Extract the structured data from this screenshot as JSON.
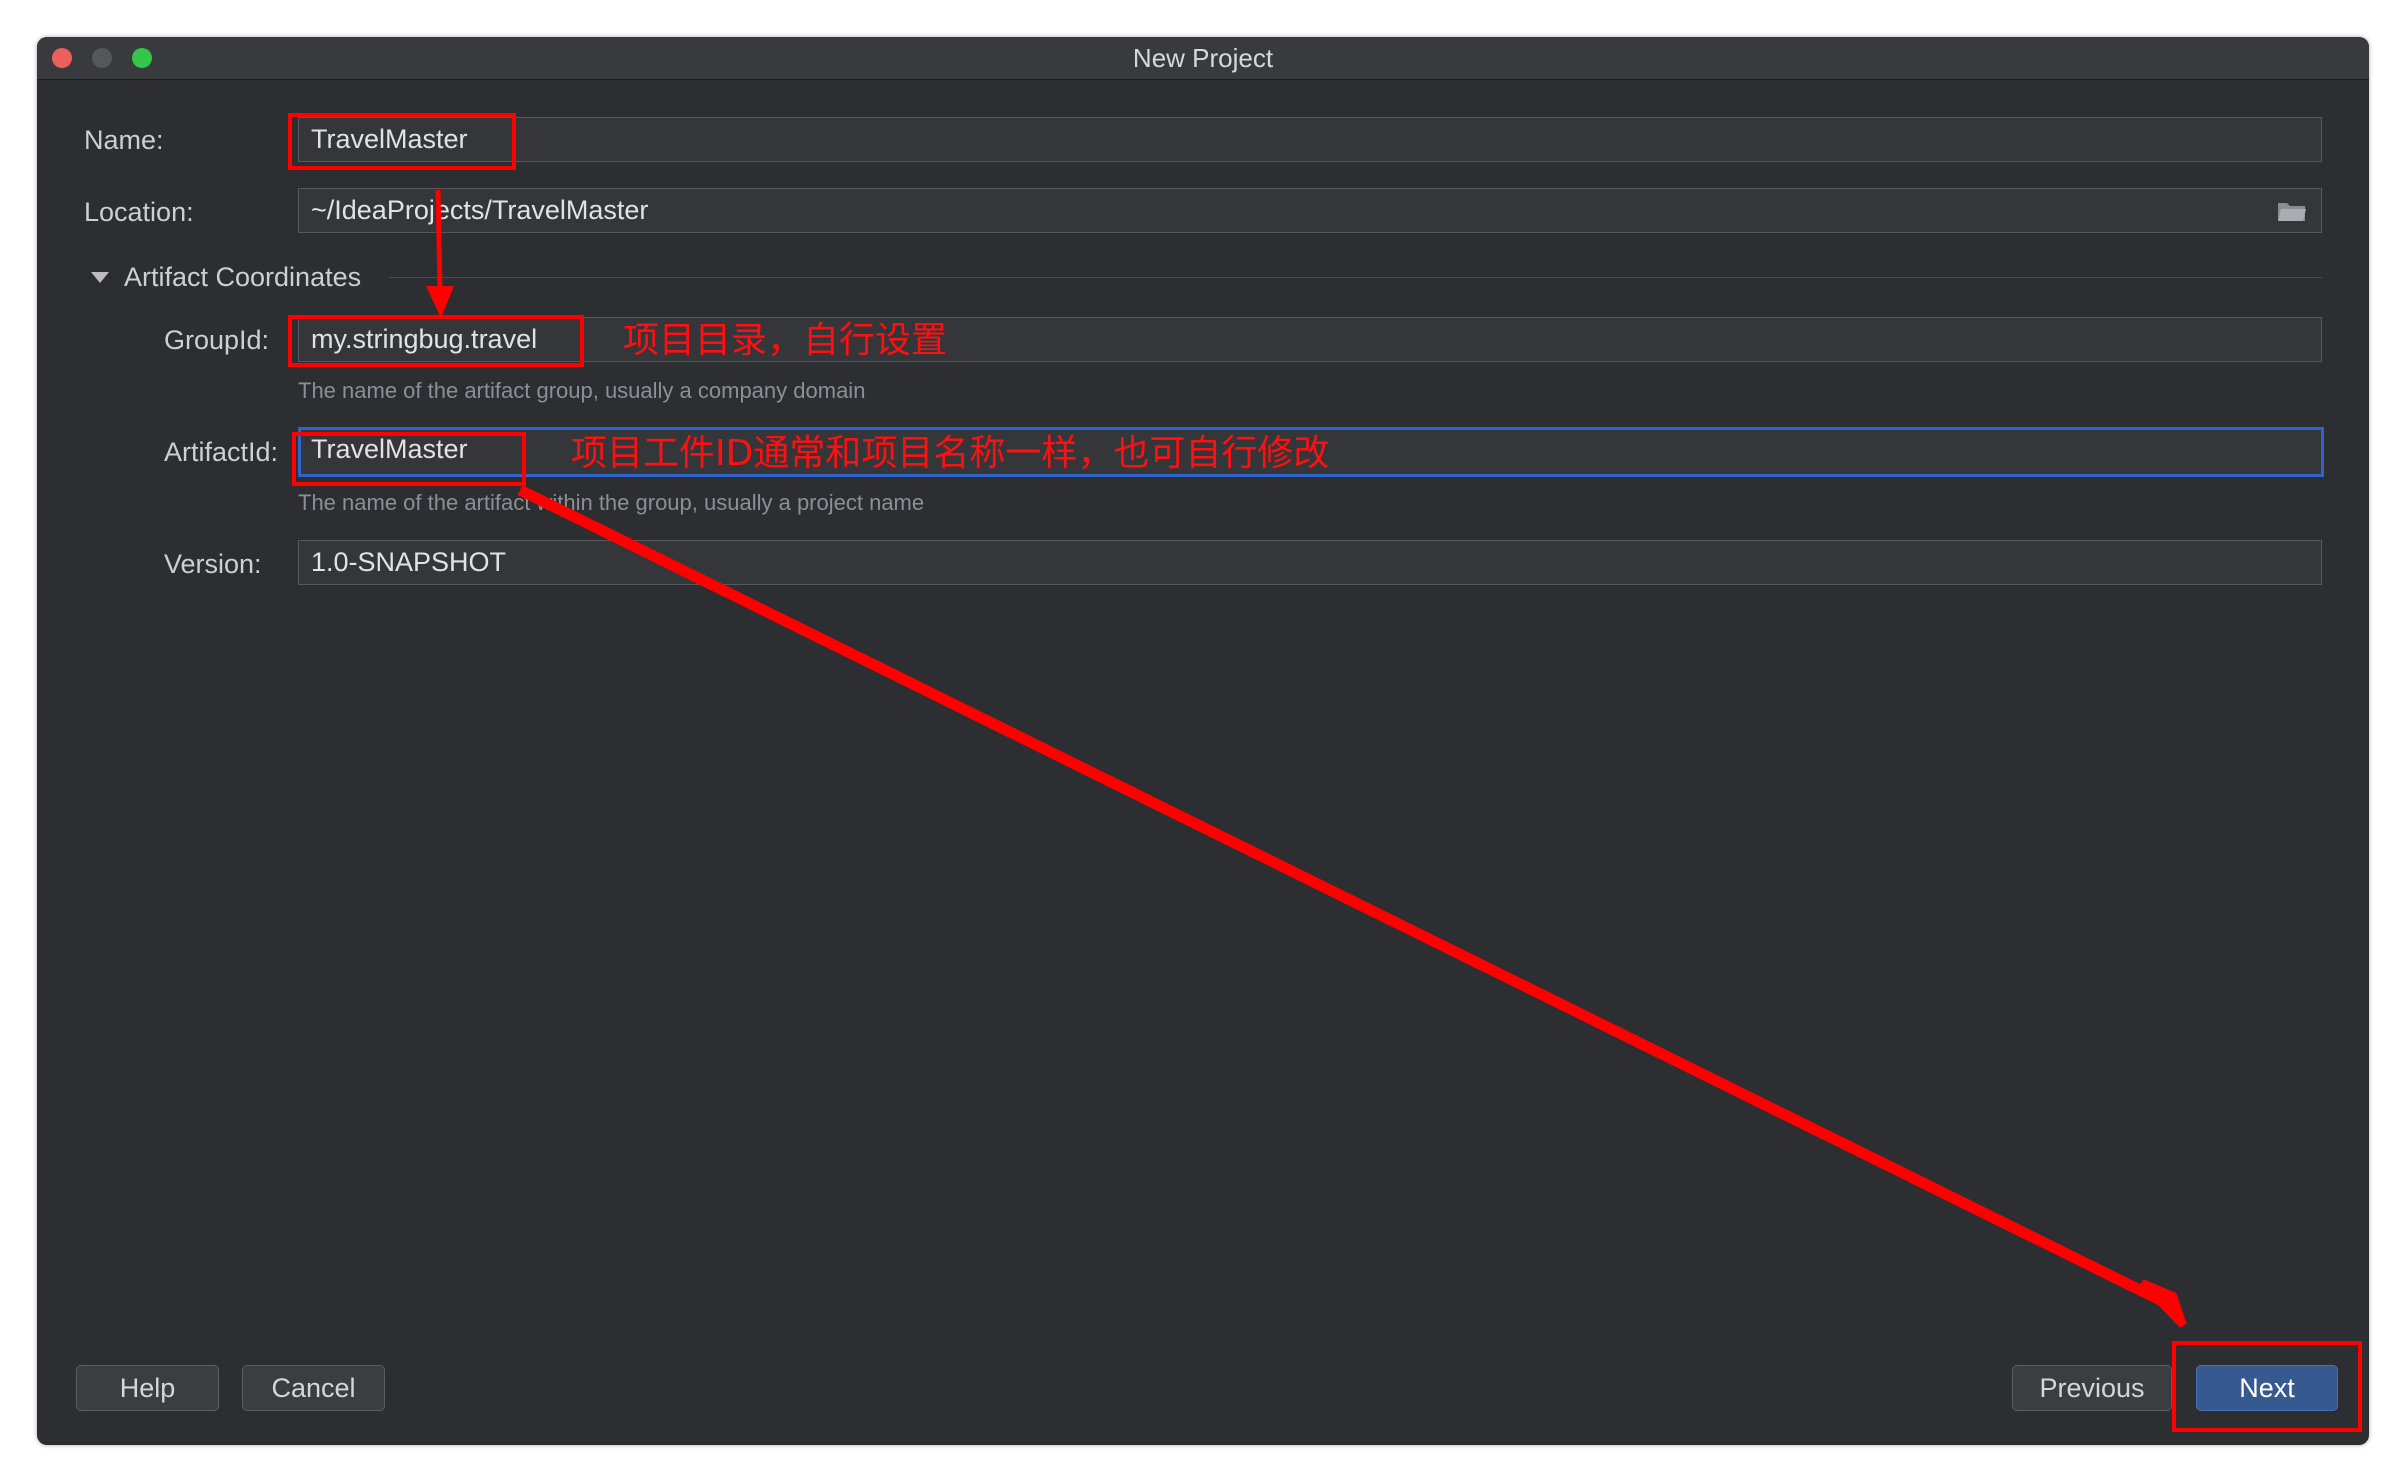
{
  "window": {
    "title": "New Project"
  },
  "form": {
    "name_label": "Name:",
    "name_value": "TravelMaster",
    "location_label": "Location:",
    "location_value": "~/IdeaProjects/TravelMaster",
    "section_title": "Artifact Coordinates",
    "groupid_label": "GroupId:",
    "groupid_value": "my.stringbug.travel",
    "groupid_hint": "The name of the artifact group, usually a company domain",
    "artifactid_label": "ArtifactId:",
    "artifactid_value": "TravelMaster",
    "artifactid_hint": "The name of the artifact within the group, usually a project name",
    "version_label": "Version:",
    "version_value": "1.0-SNAPSHOT"
  },
  "buttons": {
    "help": "Help",
    "cancel": "Cancel",
    "previous": "Previous",
    "next": "Next"
  },
  "annotations": {
    "groupid_note": "项目目录，自行设置",
    "artifactid_note": "项目工件ID通常和项目名称一样，也可自行修改",
    "color": "#ff0000"
  },
  "icons": {
    "folder": "folder-icon",
    "section_toggle": "triangle-down-icon"
  }
}
